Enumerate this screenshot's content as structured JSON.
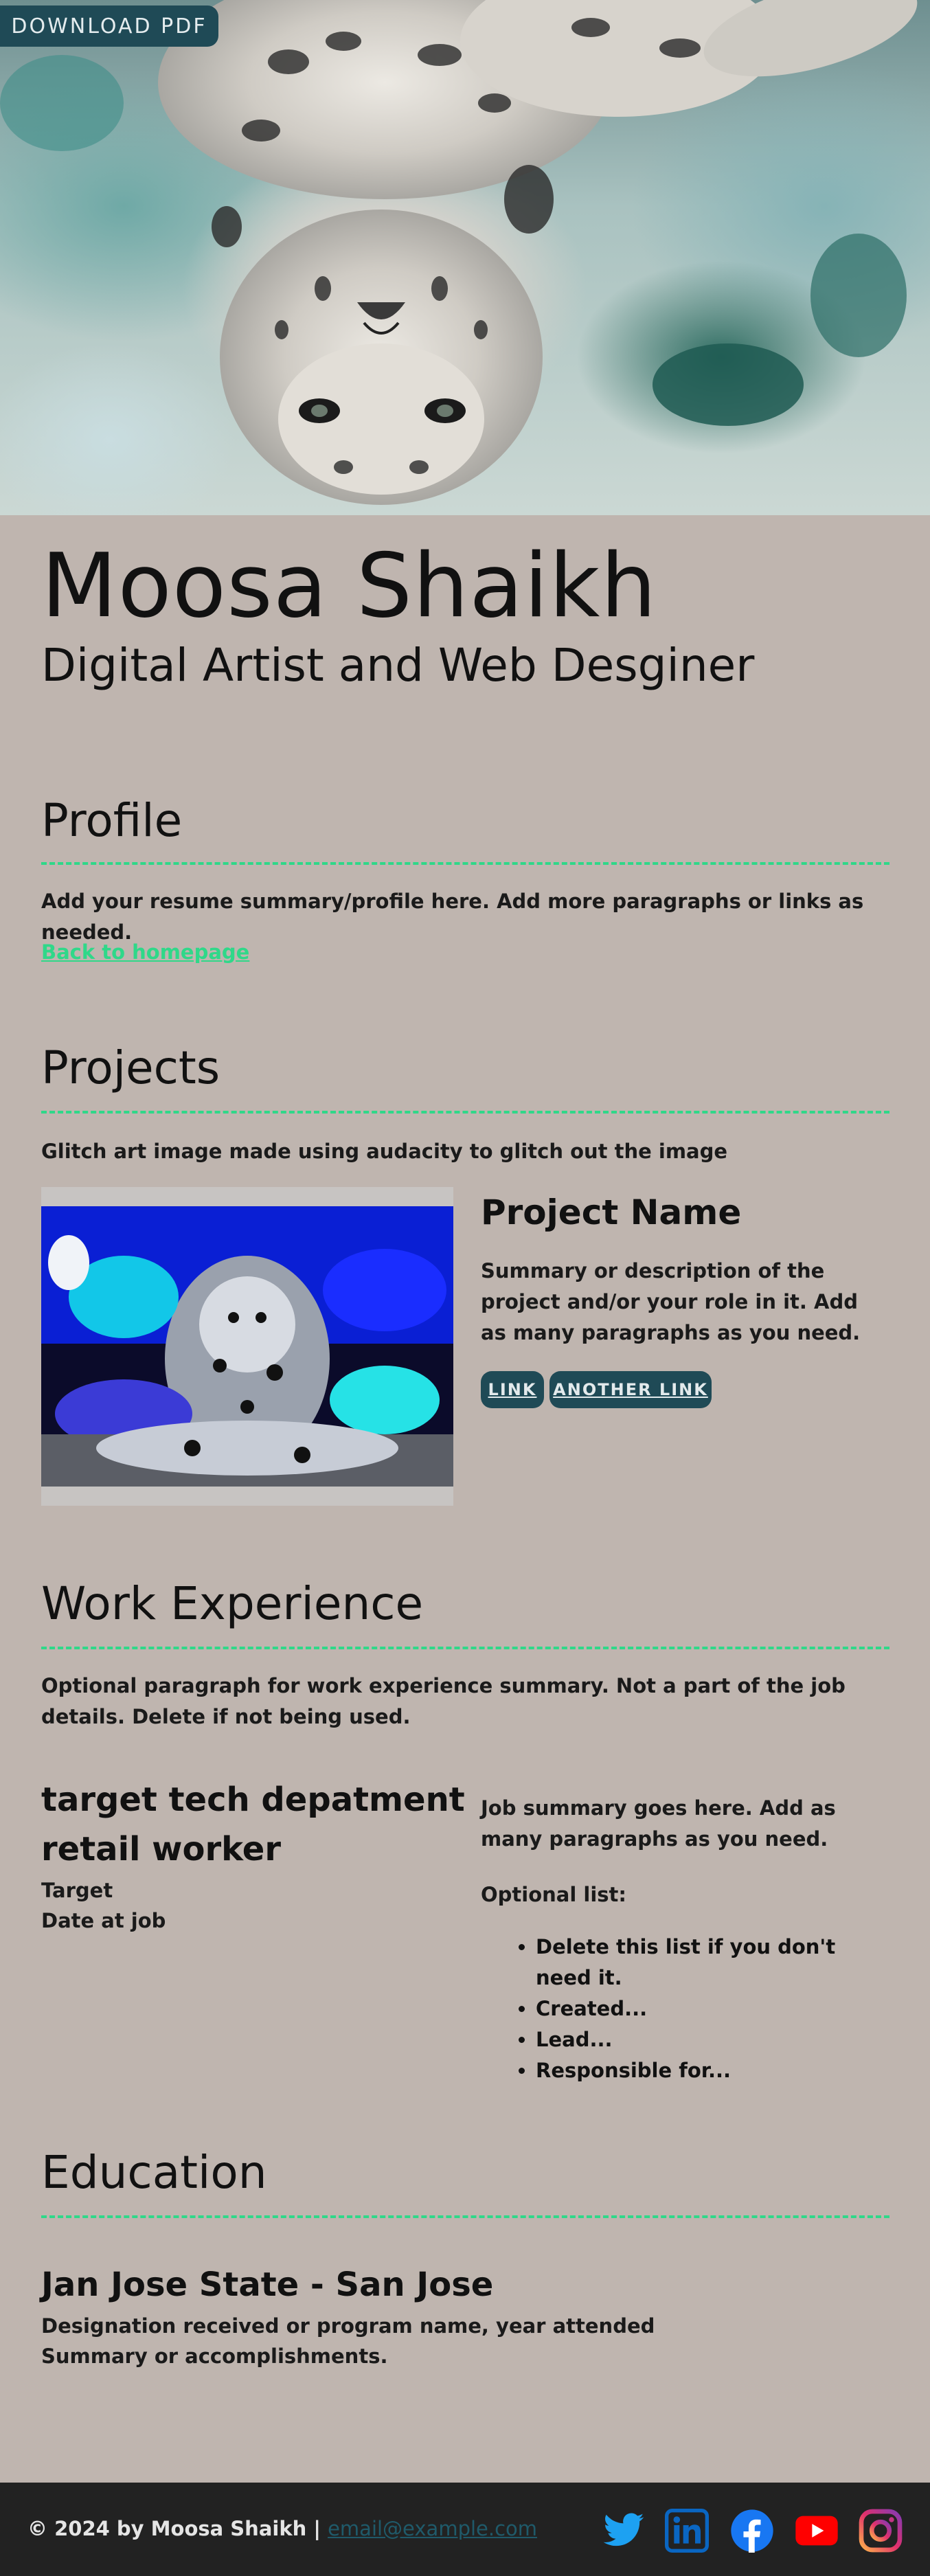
{
  "hero": {
    "download_label": "DOWNLOAD PDF",
    "image_subject": "inverted-snow-leopard-photo"
  },
  "header": {
    "name": "Moosa Shaikh",
    "subtitle": "Digital Artist and Web Desginer"
  },
  "profile": {
    "title": "Profile",
    "summary": "Add your resume summary/profile here. Add more paragraphs or links as needed.",
    "back_link": "Back to homepage"
  },
  "projects": {
    "title": "Projects",
    "intro": "Glitch art image made using audacity to glitch out the image",
    "item": {
      "name": "Project Name",
      "summary": "Summary or description of the project and/or your role in it. Add as many paragraphs as you need.",
      "link1": "LINK",
      "link2": "ANOTHER LINK",
      "image_subject": "glitched-snow-leopard-art"
    }
  },
  "work": {
    "title": "Work Experience",
    "intro": "Optional paragraph for work experience summary. Not a part of the job details. Delete if not being used.",
    "job": {
      "title1": "target tech depatment",
      "title2": "retail worker",
      "company": "Target",
      "date": "Date at job",
      "summary": "Job summary goes here. Add as many paragraphs as you need.",
      "list_label": "Optional list:",
      "list": [
        "Delete this list if you don't need it.",
        "Created...",
        "Lead...",
        "Responsible for..."
      ]
    }
  },
  "education": {
    "title": "Education",
    "school": "Jan Jose State - San Jose",
    "designation": "Designation received or program name, year attended",
    "summary": "Summary or accomplishments."
  },
  "footer": {
    "copyright": "© 2024 by Moosa Shaikh |",
    "email": "email@example.com",
    "social": [
      "twitter-icon",
      "linkedin-icon",
      "facebook-icon",
      "youtube-icon",
      "instagram-icon"
    ]
  },
  "colors": {
    "background": "#bfb5af",
    "accent": "#2fd889",
    "button": "#1f4a56",
    "footer": "#222222"
  }
}
